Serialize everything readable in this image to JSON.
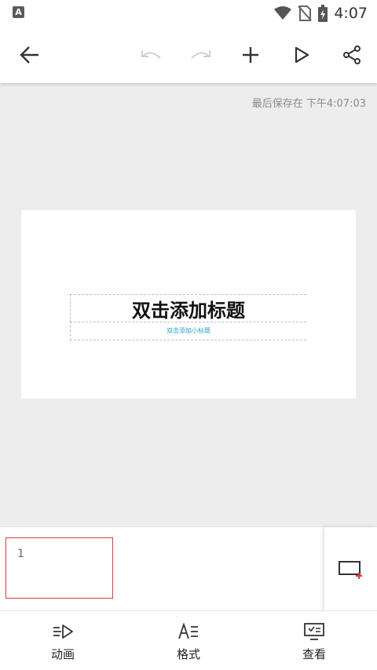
{
  "status_bar": {
    "time": "4:07",
    "app_icon": "A"
  },
  "toolbar": {
    "back": "back-arrow-icon",
    "undo": "undo-icon",
    "redo": "redo-icon",
    "add": "plus-icon",
    "play": "play-icon",
    "share": "share-icon"
  },
  "saved_text": "最后保存在 下午4:07:03",
  "slide": {
    "title_placeholder": "双击添加标题",
    "subtitle_placeholder": "双击添加小标题"
  },
  "thumbnails": [
    {
      "number": "1",
      "selected": true
    }
  ],
  "bottom_nav": [
    {
      "label": "动画",
      "icon": "animation-icon"
    },
    {
      "label": "格式",
      "icon": "format-icon"
    },
    {
      "label": "查看",
      "icon": "view-icon"
    }
  ],
  "colors": {
    "accent": "#e23b3b",
    "subtitle": "#2aa1c9",
    "background": "#ededed"
  }
}
